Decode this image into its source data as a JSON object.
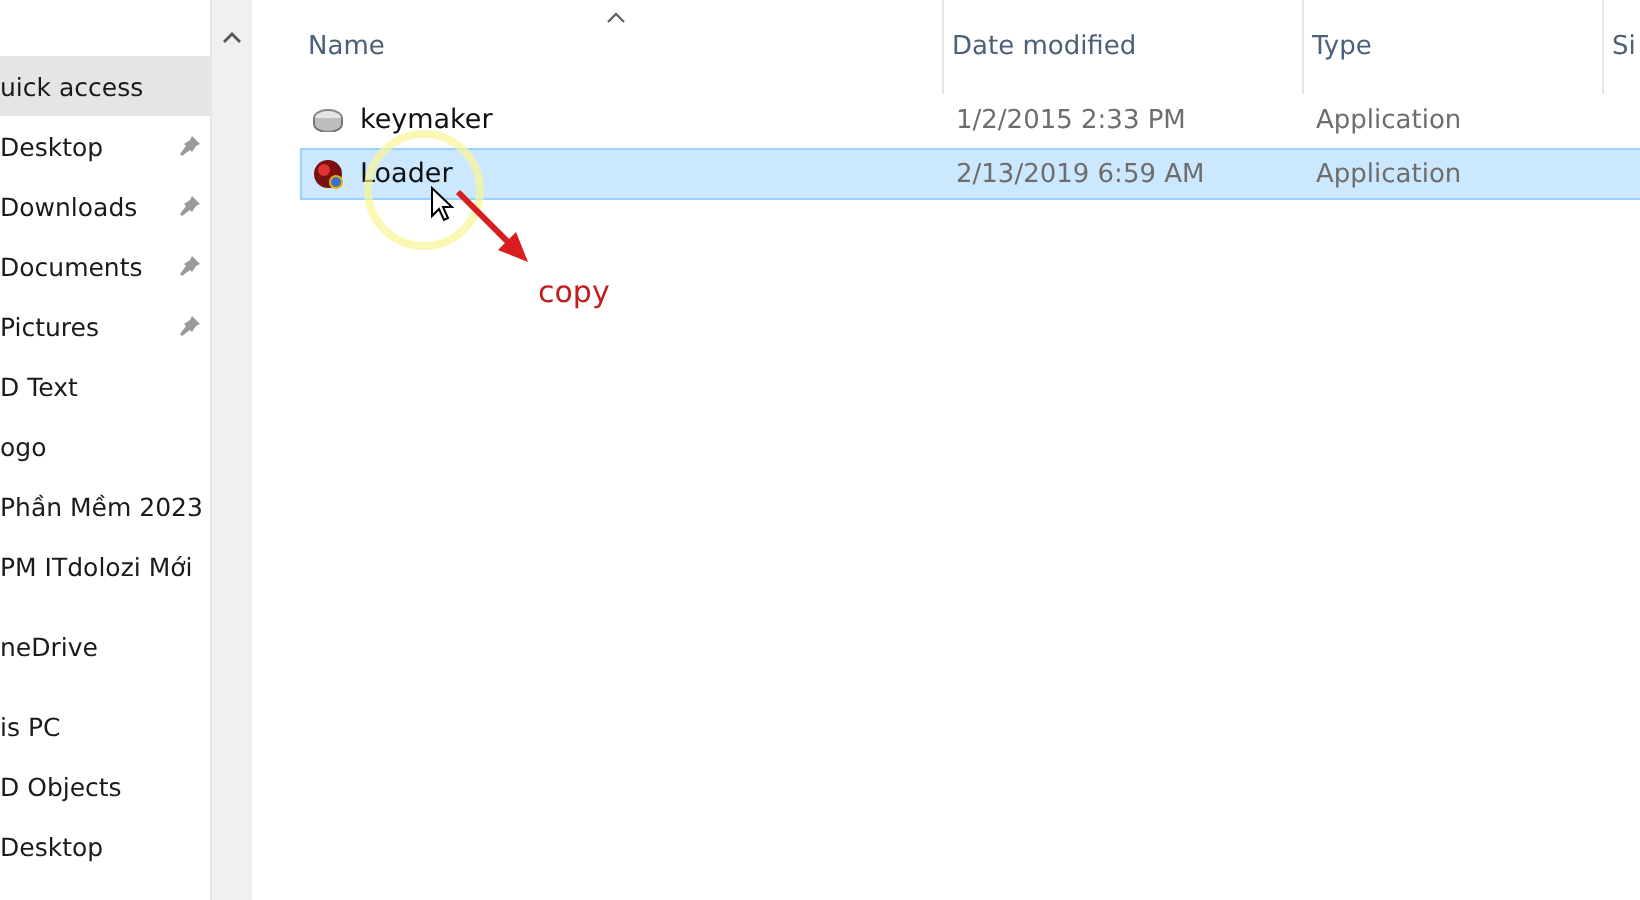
{
  "sidebar": {
    "items": [
      {
        "label": "uick access",
        "kind": "group",
        "pinned": false,
        "selected": true
      },
      {
        "label": "Desktop",
        "kind": "item",
        "pinned": true,
        "selected": false
      },
      {
        "label": "Downloads",
        "kind": "item",
        "pinned": true,
        "selected": false
      },
      {
        "label": "Documents",
        "kind": "item",
        "pinned": true,
        "selected": false
      },
      {
        "label": "Pictures",
        "kind": "item",
        "pinned": true,
        "selected": false
      },
      {
        "label": "D Text",
        "kind": "item",
        "pinned": false,
        "selected": false
      },
      {
        "label": "ogo",
        "kind": "item",
        "pinned": false,
        "selected": false
      },
      {
        "label": "Phần Mềm 2023",
        "kind": "item",
        "pinned": false,
        "selected": false
      },
      {
        "label": "PM ITdolozi Mới",
        "kind": "item",
        "pinned": false,
        "selected": false
      },
      {
        "label": "neDrive",
        "kind": "group",
        "pinned": false,
        "selected": false
      },
      {
        "label": "is PC",
        "kind": "group",
        "pinned": false,
        "selected": false
      },
      {
        "label": "D Objects",
        "kind": "item",
        "pinned": false,
        "selected": false
      },
      {
        "label": "Desktop",
        "kind": "item",
        "pinned": false,
        "selected": false
      }
    ]
  },
  "table": {
    "columns": [
      "Name",
      "Date modified",
      "Type",
      "Si"
    ],
    "rows": [
      {
        "name": "keymaker",
        "kind": "drive",
        "date": "1/2/2015 2:33 PM",
        "type": "Application",
        "selected": false
      },
      {
        "name": "Loader",
        "kind": "disc",
        "date": "2/13/2019 6:59 AM",
        "type": "Application",
        "selected": true
      }
    ]
  },
  "annotation": {
    "text": "copy"
  }
}
